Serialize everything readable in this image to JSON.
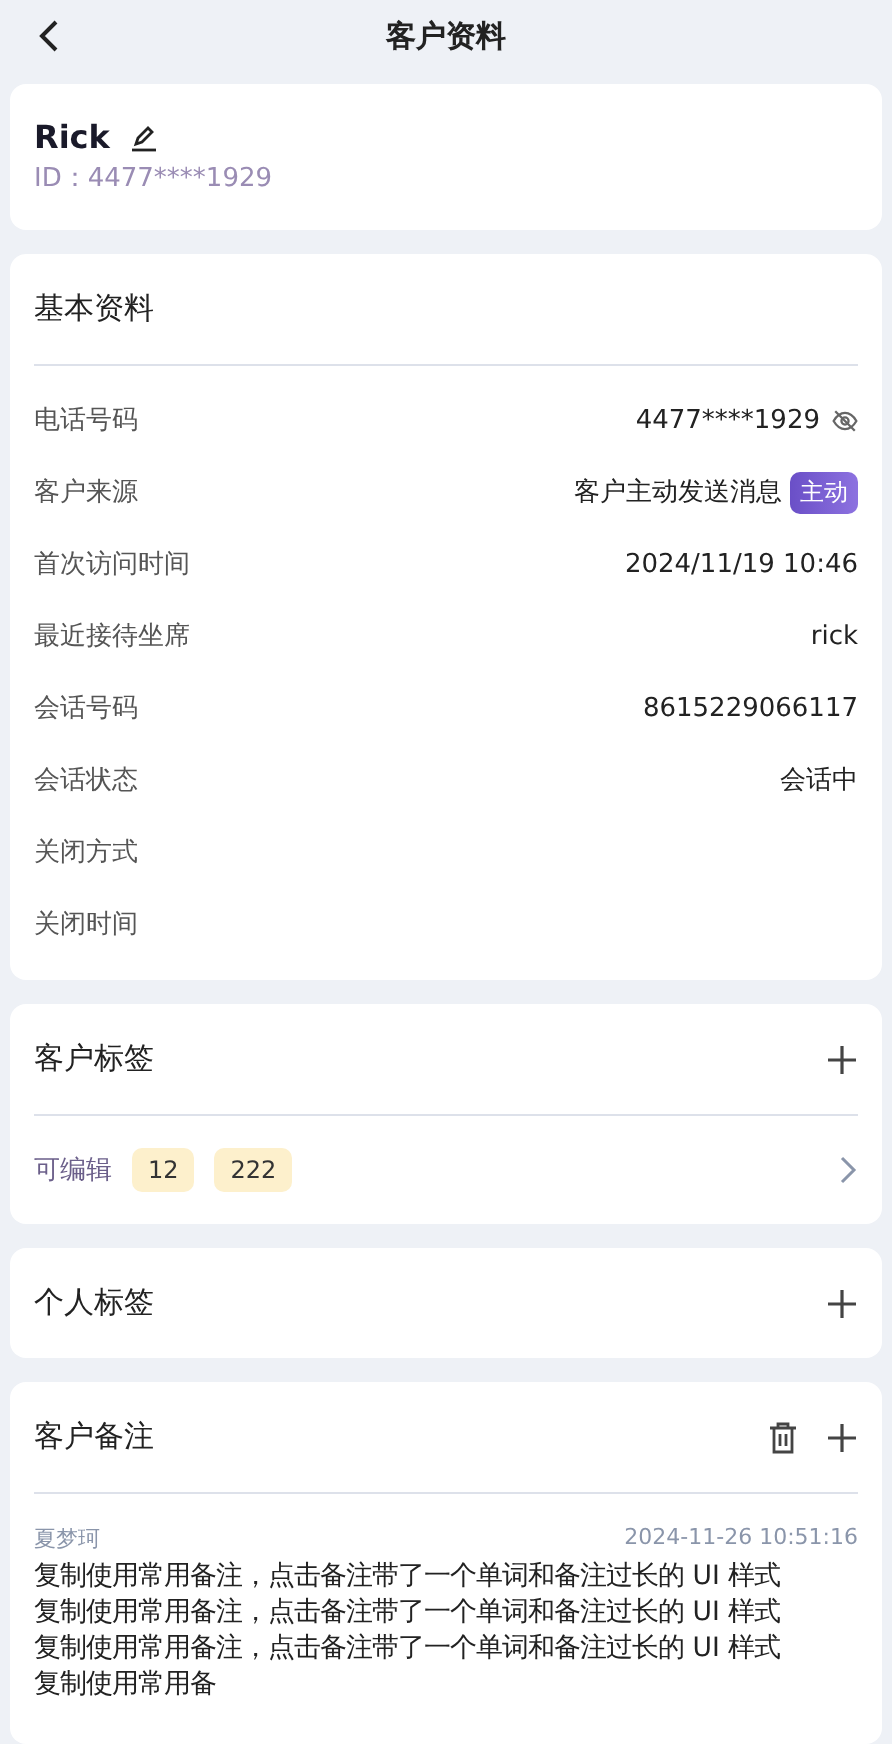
{
  "header": {
    "title": "客户资料"
  },
  "profile": {
    "name": "Rick",
    "id": "ID：4477****1929"
  },
  "basic": {
    "title": "基本资料",
    "rows": [
      {
        "label": "电话号码",
        "value": "4477****1929",
        "kind": "masked"
      },
      {
        "label": "客户来源",
        "value": "客户主动发送消息",
        "badge": "主动",
        "kind": "badge"
      },
      {
        "label": "首次访问时间",
        "value": "2024/11/19 10:46",
        "kind": "text"
      },
      {
        "label": "最近接待坐席",
        "value": "rick",
        "kind": "text"
      },
      {
        "label": "会话号码",
        "value": "8615229066117",
        "kind": "text"
      },
      {
        "label": "会话状态",
        "value": "会话中",
        "kind": "text"
      },
      {
        "label": "关闭方式",
        "kind": "text"
      },
      {
        "label": "关闭时间",
        "kind": "text"
      }
    ]
  },
  "customer_tags": {
    "title": "客户标签",
    "group": "可编辑",
    "tags": [
      "12",
      "222"
    ]
  },
  "personal_tags": {
    "title": "个人标签"
  },
  "notes": {
    "title": "客户备注",
    "items": [
      {
        "author": "夏梦珂",
        "time": "2024-11-26 10:51:16",
        "text": "复制使用常用备注，点击备注带了一个单词和备注过长的 UI 样式复制使用常用备注，点击备注带了一个单词和备注过长的 UI 样式复制使用常用备注，点击备注带了一个单词和备注过长的 UI 样式复制使用常用备"
      }
    ]
  }
}
